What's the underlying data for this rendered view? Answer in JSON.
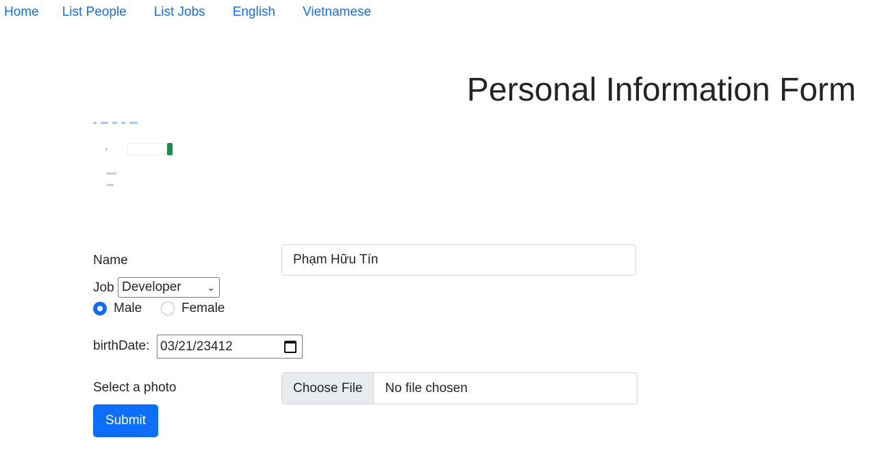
{
  "nav": {
    "home": "Home",
    "list_people": "List People",
    "list_jobs": "List Jobs",
    "english": "English",
    "vietnamese": "Vietnamese"
  },
  "page_title": "Personal Information Form",
  "form": {
    "name_label": "Name",
    "name_value": "Phạm Hữu Tín",
    "job_label": "Job",
    "job_selected": "Developer",
    "gender_male": "Male",
    "gender_female": "Female",
    "gender_selected": "Male",
    "birthdate_label": "birthDate:",
    "birthdate_value": "03/21/23412",
    "photo_label": "Select a photo",
    "choose_file": "Choose File",
    "no_file": "No file chosen",
    "submit": "Submit"
  },
  "colors": {
    "accent": "#0d6efd",
    "text": "#212529",
    "thumbnail_button": "#1e8a4c"
  },
  "icons": [
    "chevron-down-icon",
    "calendar-icon"
  ]
}
